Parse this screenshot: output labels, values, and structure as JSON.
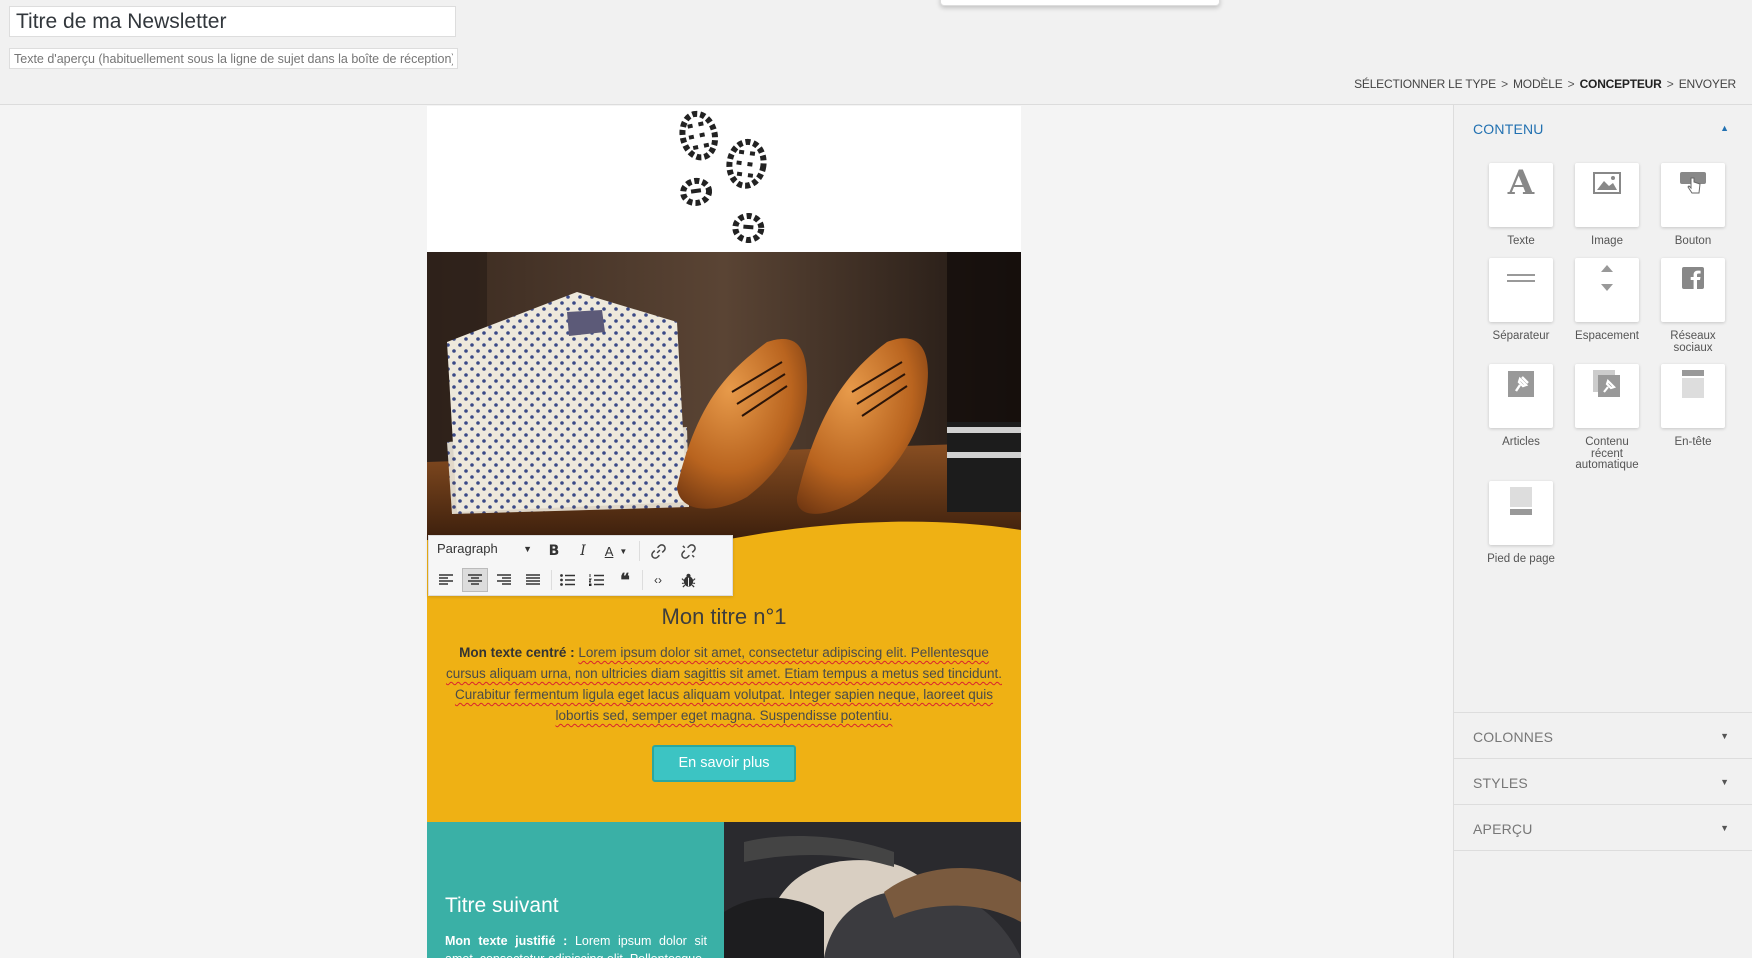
{
  "header": {
    "subject_value": "Titre de ma Newsletter",
    "preheader_placeholder": "Texte d'aperçu (habituellement sous la ligne de sujet dans la boîte de réception)"
  },
  "breadcrumb": {
    "steps": [
      "SÉLECTIONNER LE TYPE",
      "MODÈLE",
      "CONCEPTEUR",
      "ENVOYER"
    ],
    "separator": ">",
    "current_index": 2
  },
  "toolbar": {
    "format_select": "Paragraph",
    "buttons_row1": [
      "bold-icon",
      "italic-icon",
      "text-color-icon",
      "link-icon",
      "unlink-icon"
    ],
    "buttons_row2": [
      "align-left-icon",
      "align-center-icon",
      "align-right-icon",
      "align-justify-icon",
      "bullet-list-icon",
      "numbered-list-icon",
      "blockquote-icon",
      "code-icon",
      "bug-icon"
    ]
  },
  "newsletter": {
    "section1": {
      "title": "Mon titre n°1",
      "text_bold": "Mon texte centré :",
      "text_body": "Lorem ipsum dolor sit amet, consectetur adipiscing elit. Pellentesque cursus aliquam urna, non ultricies diam sagittis sit amet. Etiam tempus a metus sed tincidunt. Curabitur fermentum ligula eget lacus aliquam volutpat. Integer sapien neque, laoreet quis lobortis sed, semper eget magna. Suspendisse potentiu.",
      "button_label": "En savoir plus",
      "background": "#efb114",
      "button_color": "#3cc4c3"
    },
    "section2": {
      "title": "Titre suivant",
      "text_bold": "Mon texte justifié :",
      "text_body": "Lorem ipsum dolor sit amet, consectetur adipiscing elit. Pellentesque",
      "background": "#3ab0a6"
    }
  },
  "sidebar": {
    "contenu": {
      "label": "CONTENU",
      "widgets": [
        {
          "label": "Texte",
          "icon": "text-icon"
        },
        {
          "label": "Image",
          "icon": "image-icon"
        },
        {
          "label": "Bouton",
          "icon": "button-hand-icon"
        },
        {
          "label": "Séparateur",
          "icon": "separator-icon"
        },
        {
          "label": "Espacement",
          "icon": "spacer-icon"
        },
        {
          "label": "Réseaux sociaux",
          "icon": "facebook-icon"
        },
        {
          "label": "Articles",
          "icon": "pin-icon"
        },
        {
          "label": "Contenu récent automatique",
          "icon": "recent-content-icon"
        },
        {
          "label": "En-tête",
          "icon": "header-icon"
        },
        {
          "label": "Pied de page",
          "icon": "footer-icon"
        }
      ]
    },
    "colonnes": {
      "label": "COLONNES"
    },
    "styles": {
      "label": "STYLES"
    },
    "apercu": {
      "label": "APERÇU"
    }
  },
  "colors": {
    "accent": "#2271b1"
  }
}
